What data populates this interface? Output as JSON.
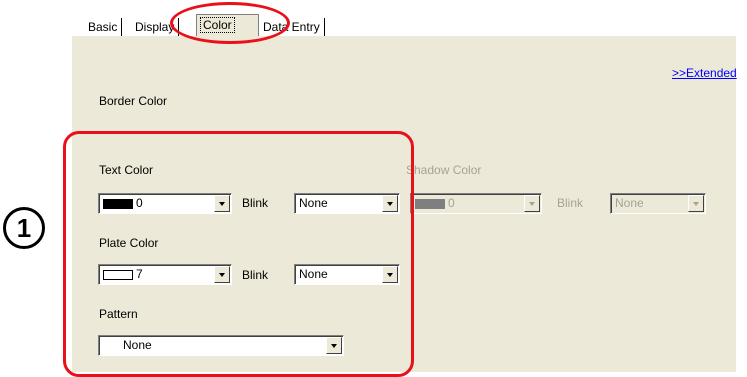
{
  "tabs": [
    {
      "label": "Basic",
      "active": false
    },
    {
      "label": "Display",
      "active": false
    },
    {
      "label": "Color",
      "active": true
    },
    {
      "label": "Data Entry",
      "active": false
    }
  ],
  "extended_link": ">>Extended",
  "labels": {
    "border_color": "Border Color",
    "text_color": "Text Color",
    "shadow_color": "Shadow Color",
    "plate_color": "Plate Color",
    "pattern": "Pattern",
    "blink": "Blink"
  },
  "fields": {
    "text_color": {
      "value": "0",
      "swatch": "black"
    },
    "text_blink": {
      "value": "None"
    },
    "shadow_color": {
      "value": "0",
      "swatch": "black",
      "disabled": true
    },
    "shadow_blink": {
      "value": "None",
      "disabled": true
    },
    "plate_color": {
      "value": "7",
      "swatch": "white"
    },
    "plate_blink": {
      "value": "None"
    },
    "pattern": {
      "value": "None"
    }
  },
  "annotation": {
    "number": "1",
    "color": "#e8101a"
  },
  "colors": {
    "panel_bg": "#ece9d8",
    "disabled_text": "#a6a394",
    "link": "#0000ff"
  }
}
